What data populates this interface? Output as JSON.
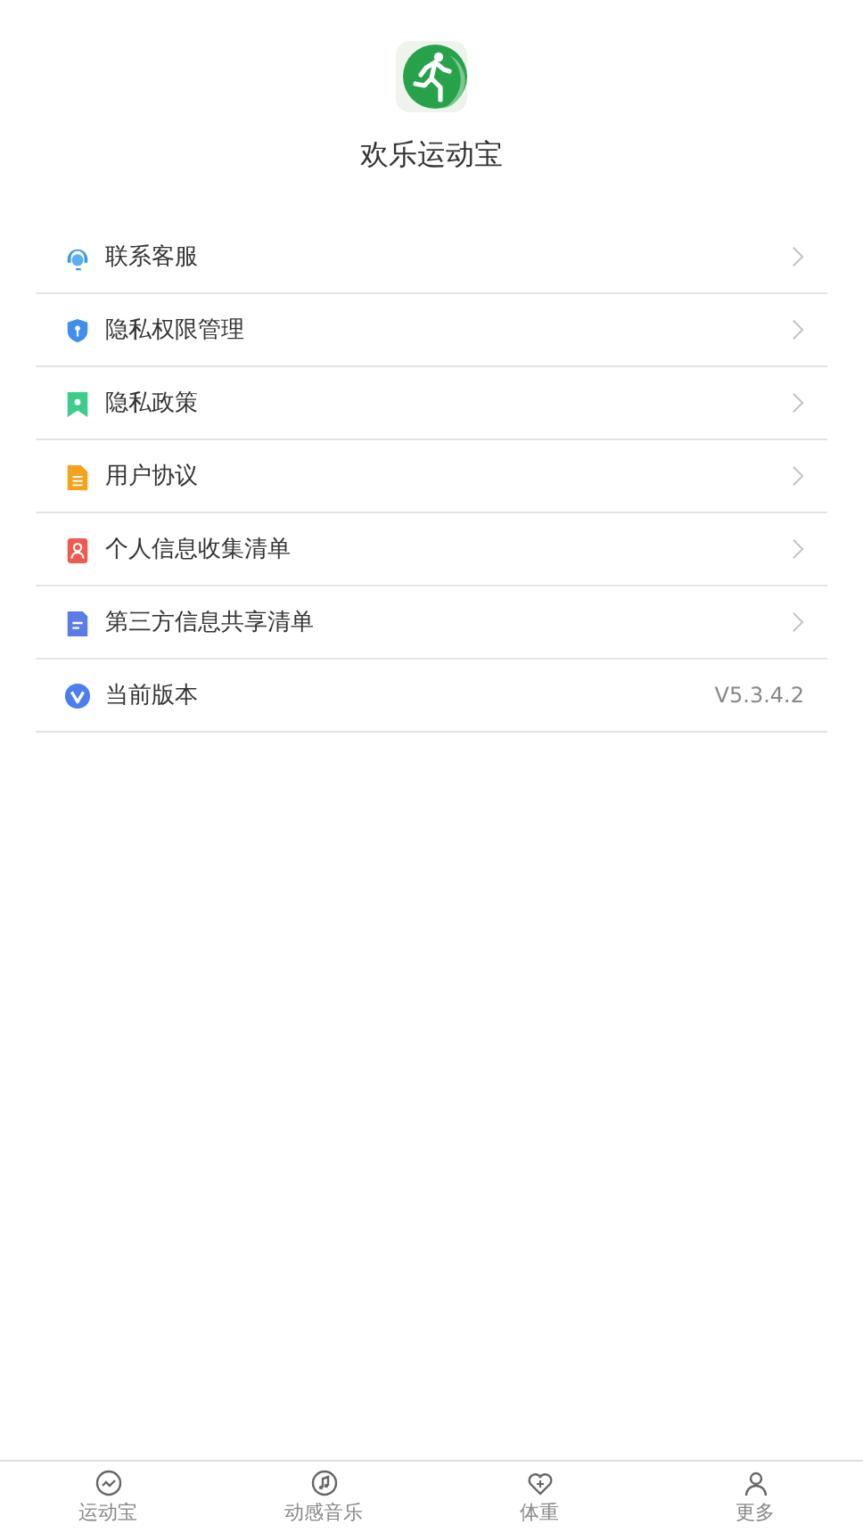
{
  "app": {
    "name": "欢乐运动宝"
  },
  "menu": [
    {
      "label": "联系客服",
      "kind": "link"
    },
    {
      "label": "隐私权限管理",
      "kind": "link"
    },
    {
      "label": "隐私政策",
      "kind": "link"
    },
    {
      "label": "用户协议",
      "kind": "link"
    },
    {
      "label": "个人信息收集清单",
      "kind": "link"
    },
    {
      "label": "第三方信息共享清单",
      "kind": "link"
    },
    {
      "label": "当前版本",
      "kind": "version",
      "value": "V5.3.4.2"
    }
  ],
  "tab_bar": [
    {
      "label": "运动宝"
    },
    {
      "label": "动感音乐"
    },
    {
      "label": "体重"
    },
    {
      "label": "更多"
    }
  ]
}
